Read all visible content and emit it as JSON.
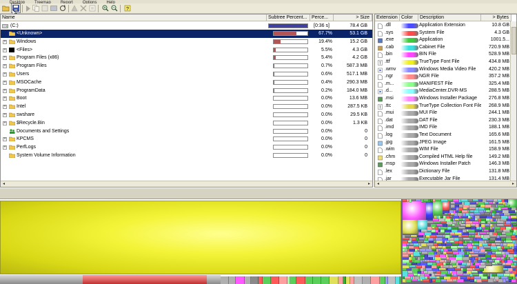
{
  "menu": [
    "Desktop",
    "Treemap",
    "Report",
    "Options",
    "Help"
  ],
  "toolbar": {
    "icons": [
      "open-icon",
      "save-icon",
      "play-icon",
      "copy-icon",
      "refresh-icon",
      "delete-icon",
      "explorer-icon",
      "cleanup-icon",
      "zoom-in-icon",
      "zoom-out-icon",
      "help-icon"
    ]
  },
  "tree": {
    "columns": [
      "Name",
      "Subtree Percent...",
      "Perce...",
      "> Size"
    ],
    "root": {
      "name": "(C:)",
      "subtree": "[0:36 s]",
      "size": "78.4 GB",
      "fill": 100
    },
    "rows": [
      {
        "name": "<Unknown>",
        "percent": "67.7%",
        "size": "53.1 GB",
        "fill": 67.7,
        "selected": true,
        "icon": "folder",
        "expand": false
      },
      {
        "name": "Windows",
        "percent": "19.4%",
        "size": "15.2 GB",
        "fill": 19.4,
        "icon": "folder",
        "expand": true
      },
      {
        "name": "<Files>",
        "percent": "5.5%",
        "size": "4.3 GB",
        "fill": 5.5,
        "icon": "black",
        "expand": true
      },
      {
        "name": "Program Files (x86)",
        "percent": "5.4%",
        "size": "4.2 GB",
        "fill": 5.4,
        "icon": "folder",
        "expand": true
      },
      {
        "name": "Program Files",
        "percent": "0.7%",
        "size": "587.3 MB",
        "fill": 0.7,
        "icon": "folder",
        "expand": true
      },
      {
        "name": "Users",
        "percent": "0.6%",
        "size": "517.1 MB",
        "fill": 0.6,
        "icon": "folder",
        "expand": true
      },
      {
        "name": "MSOCache",
        "percent": "0.4%",
        "size": "290.3 MB",
        "fill": 0.4,
        "icon": "folder",
        "expand": true
      },
      {
        "name": "ProgramData",
        "percent": "0.2%",
        "size": "184.0 MB",
        "fill": 0.2,
        "icon": "folder",
        "expand": true
      },
      {
        "name": "Boot",
        "percent": "0.0%",
        "size": "13.6 MB",
        "fill": 0,
        "icon": "folder",
        "expand": true
      },
      {
        "name": "Intel",
        "percent": "0.0%",
        "size": "287.5 KB",
        "fill": 0,
        "icon": "folder",
        "expand": true
      },
      {
        "name": "swshare",
        "percent": "0.0%",
        "size": "29.5 KB",
        "fill": 0,
        "icon": "folder",
        "expand": true
      },
      {
        "name": "$Recycle.Bin",
        "percent": "0.0%",
        "size": "1.3 KB",
        "fill": 0,
        "icon": "folder",
        "expand": true
      },
      {
        "name": "Documents and Settings",
        "percent": "0.0%",
        "size": "0",
        "fill": 0,
        "icon": "green",
        "expand": false
      },
      {
        "name": "KPCMS",
        "percent": "0.0%",
        "size": "0",
        "fill": 0,
        "icon": "folder",
        "expand": true
      },
      {
        "name": "PerfLogs",
        "percent": "0.0%",
        "size": "0",
        "fill": 0,
        "icon": "folder",
        "expand": true
      },
      {
        "name": "System Volume Information",
        "percent": "0.0%",
        "size": "0",
        "fill": 0,
        "icon": "folder",
        "expand": false
      }
    ]
  },
  "extensions": {
    "columns": [
      "Extension",
      "Color",
      "Description",
      "> Bytes"
    ],
    "rows": [
      {
        "ext": ".dll",
        "color": "#4a4aff",
        "desc": "Application Extension",
        "bytes": "10.8 GB",
        "icon": "file"
      },
      {
        "ext": ".sys",
        "color": "#ff4a4a",
        "desc": "System File",
        "bytes": "4.3 GB",
        "icon": "file"
      },
      {
        "ext": ".exe",
        "color": "#3ccc3c",
        "desc": "Application",
        "bytes": "1001.5...",
        "icon": "app"
      },
      {
        "ext": ".cab",
        "color": "#3ce0e0",
        "desc": "Cabinet File",
        "bytes": "720.9 MB",
        "icon": "cab"
      },
      {
        "ext": ".bin",
        "color": "#ff44ff",
        "desc": "BIN File",
        "bytes": "528.9 MB",
        "icon": "file"
      },
      {
        "ext": ".ttf",
        "color": "#f0f020",
        "desc": "TrueType Font File",
        "bytes": "434.8 MB",
        "icon": "font"
      },
      {
        "ext": ".wmv",
        "color": "#8a8aff",
        "desc": "Windows Media Video File",
        "bytes": "420.2 MB",
        "icon": "media"
      },
      {
        "ext": ".ngr",
        "color": "#ff8a8a",
        "desc": "NGR File",
        "bytes": "357.2 MB",
        "icon": "file"
      },
      {
        "ext": ".m...",
        "color": "#8aff8a",
        "desc": "MANIFEST File",
        "bytes": "325.4 MB",
        "icon": "file"
      },
      {
        "ext": ".d...",
        "color": "#8affff",
        "desc": "MediaCenter.DVR-MS",
        "bytes": "288.5 MB",
        "icon": "media"
      },
      {
        "ext": ".msi",
        "color": "#ff8aff",
        "desc": "Windows Installer Package",
        "bytes": "276.8 MB",
        "icon": "pkg"
      },
      {
        "ext": ".ttc",
        "color": "#e6d84a",
        "desc": "TrueType Collection Font File",
        "bytes": "268.9 MB",
        "icon": "font"
      },
      {
        "ext": ".mui",
        "color": "#aaaaaa",
        "desc": "MUI File",
        "bytes": "244.1 MB",
        "icon": "file"
      },
      {
        "ext": ".dat",
        "color": "#aaaaaa",
        "desc": "DAT File",
        "bytes": "230.3 MB",
        "icon": "file"
      },
      {
        "ext": ".imd",
        "color": "#aaaaaa",
        "desc": "IMD File",
        "bytes": "188.1 MB",
        "icon": "file"
      },
      {
        "ext": ".log",
        "color": "#aaaaaa",
        "desc": "Text Document",
        "bytes": "165.6 MB",
        "icon": "file"
      },
      {
        "ext": ".jpg",
        "color": "#aaaaaa",
        "desc": "JPEG Image",
        "bytes": "161.5 MB",
        "icon": "img"
      },
      {
        "ext": ".wim",
        "color": "#aaaaaa",
        "desc": "WIM File",
        "bytes": "158.9 MB",
        "icon": "file"
      },
      {
        "ext": ".chm",
        "color": "#aaaaaa",
        "desc": "Compiled HTML Help file",
        "bytes": "149.2 MB",
        "icon": "help"
      },
      {
        "ext": ".msp",
        "color": "#aaaaaa",
        "desc": "Windows Installer Patch",
        "bytes": "146.3 MB",
        "icon": "pkg"
      },
      {
        "ext": ".lex",
        "color": "#aaaaaa",
        "desc": "Dictionary File",
        "bytes": "131.8 MB",
        "icon": "file"
      },
      {
        "ext": ".jar",
        "color": "#aaaaaa",
        "desc": "Executable Jar File",
        "bytes": "131.4 MB",
        "icon": "file"
      }
    ]
  },
  "colors": {
    "selection": "#0a246a",
    "bar_fill": "#b25555",
    "treemap_unknown": "#f2f22e",
    "treemap_gray": "#b0b0b0"
  }
}
